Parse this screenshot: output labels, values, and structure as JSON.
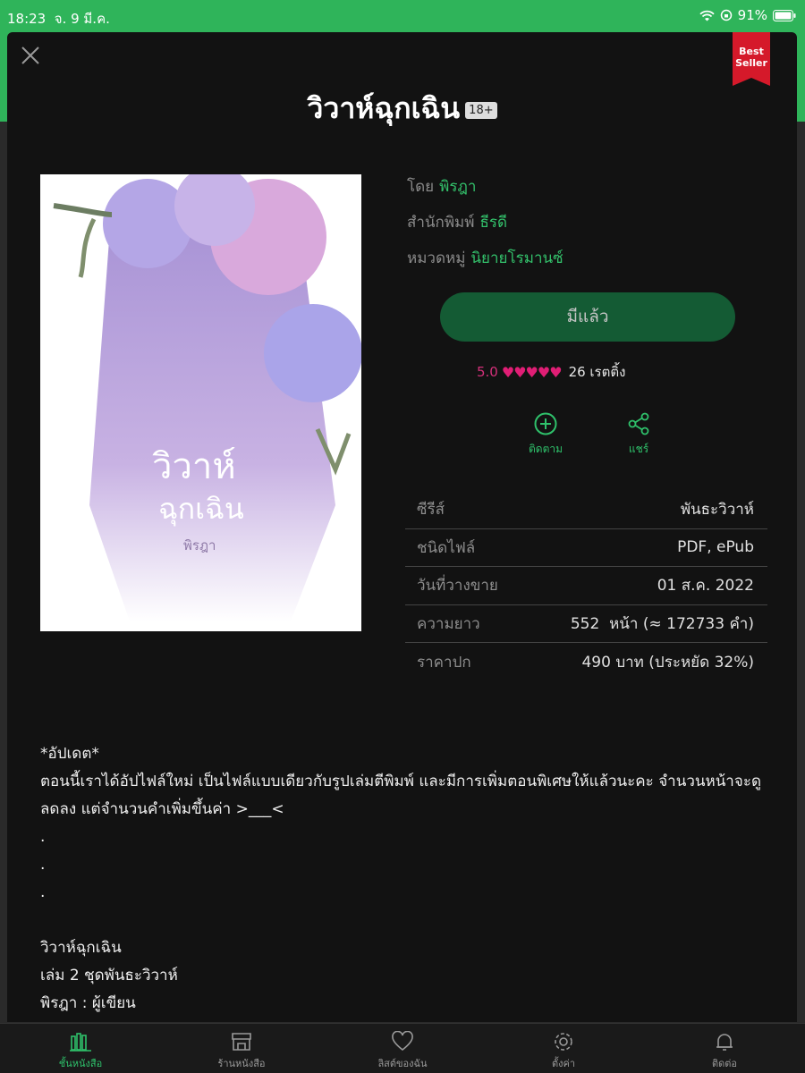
{
  "status_bar": {
    "time": "18:23",
    "date": "จ. 9 มี.ค.",
    "battery": "91%"
  },
  "book": {
    "title": "วิวาห์ฉุกเฉิน",
    "age_rating": "18+",
    "ribbon_line1": "Best",
    "ribbon_line2": "Seller",
    "cover_title_line1": "วิวาห์",
    "cover_title_line2": "ฉุกเฉิน",
    "cover_author": "พิรฎา"
  },
  "meta": [
    {
      "label": "โดย",
      "value": "พิรฎา"
    },
    {
      "label": "สำนักพิมพ์",
      "value": "ธีรดี"
    },
    {
      "label": "หมวดหมู่",
      "value": "นิยายโรมานซ์"
    }
  ],
  "own_button": "มีแล้ว",
  "rating": {
    "score": "5.0",
    "hearts": "♥♥♥♥♥",
    "count": "26 เรตติ้ง"
  },
  "actions": {
    "follow": "ติดตาม",
    "share": "แชร์"
  },
  "info": [
    {
      "key": "ซีรีส์",
      "value": "พันธะวิวาห์"
    },
    {
      "key": "ชนิดไฟล์",
      "value": "PDF, ePub"
    },
    {
      "key": "วันที่วางขาย",
      "value": "01 ส.ค. 2022"
    },
    {
      "key": "ความยาว",
      "value": "552  หน้า (≈ 172733 คำ)"
    },
    {
      "key": "ราคาปก",
      "value": "490 บาท (ประหยัด 32%)"
    }
  ],
  "description": [
    "*อัปเดต*",
    "ตอนนี้เราได้อัปไฟล์ใหม่ เป็นไฟล์แบบเดียวกับรูปเล่มตีพิมพ์ และมีการเพิ่มตอนพิเศษให้แล้วนะคะ จำนวนหน้าจะดู",
    "ลดลง แต่จำนวนคำเพิ่มขึ้นค่า >___<",
    ".",
    ".",
    ".",
    "",
    "วิวาห์ฉุกเฉิน",
    "เล่ม 2 ชุดพันธะวิวาห์",
    "พิรฎา : ผู้เขียน"
  ],
  "tabs": [
    {
      "label": "ชั้นหนังสือ",
      "icon": "bookshelf-icon"
    },
    {
      "label": "ร้านหนังสือ",
      "icon": "store-icon"
    },
    {
      "label": "ลิสต์ของฉัน",
      "icon": "heart-icon"
    },
    {
      "label": "ตั้งค่า",
      "icon": "gear-icon"
    },
    {
      "label": "ติดต่อ",
      "icon": "bell-icon"
    }
  ],
  "colors": {
    "accent": "#2fc16b",
    "status_green": "#2fb45a",
    "button_bg": "#145b34",
    "heart": "#e01e75",
    "ribbon": "#d5192a"
  }
}
